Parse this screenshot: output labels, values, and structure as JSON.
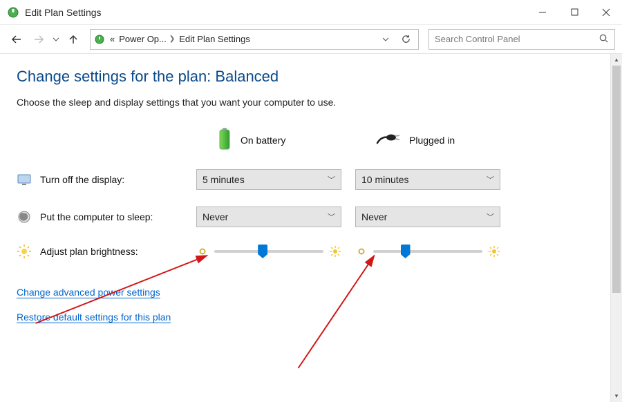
{
  "window": {
    "title": "Edit Plan Settings"
  },
  "breadcrumb": {
    "item1": "Power Op...",
    "item2": "Edit Plan Settings"
  },
  "search": {
    "placeholder": "Search Control Panel"
  },
  "page": {
    "title": "Change settings for the plan: Balanced",
    "subtitle": "Choose the sleep and display settings that you want your computer to use."
  },
  "columns": {
    "battery": "On battery",
    "plugged": "Plugged in"
  },
  "rows": {
    "display": {
      "label": "Turn off the display:",
      "battery": "5 minutes",
      "plugged": "10 minutes"
    },
    "sleep": {
      "label": "Put the computer to sleep:",
      "battery": "Never",
      "plugged": "Never"
    },
    "brightness": {
      "label": "Adjust plan brightness:",
      "battery_percent": 40,
      "plugged_percent": 25
    }
  },
  "links": {
    "advanced": "Change advanced power settings",
    "restore": "Restore default settings for this plan"
  },
  "colors": {
    "heading": "#0a4a8a",
    "link": "#0066cc",
    "accent": "#0078d7",
    "arrow": "#d11818"
  }
}
